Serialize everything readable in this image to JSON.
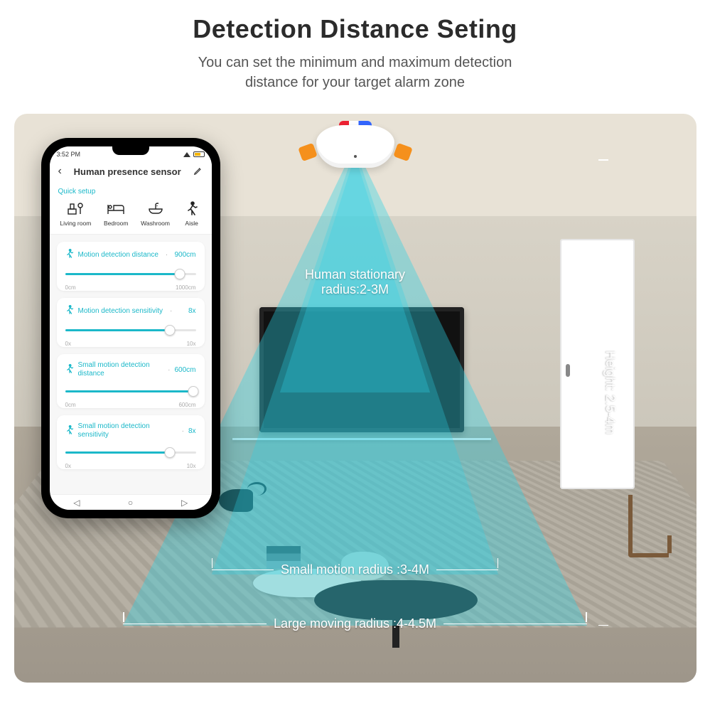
{
  "header": {
    "title": "Detection Distance Seting",
    "subtitle_l1": "You can set the minimum and maximum detection",
    "subtitle_l2": "distance for your target alarm zone"
  },
  "annotations": {
    "stationary_l1": "Human stationary",
    "stationary_l2": "radius:2-3M",
    "small_motion": "Small motion radius :3-4M",
    "large_motion": "Large moving radius :4-4.5M",
    "height": "Height: 2.5-4m"
  },
  "phone": {
    "status_time": "3:52 PM",
    "title": "Human presence sensor",
    "quick_label": "Quick setup",
    "quick": [
      {
        "label": "Living room"
      },
      {
        "label": "Bedroom"
      },
      {
        "label": "Washroom"
      },
      {
        "label": "Aisle"
      }
    ],
    "sliders": [
      {
        "name": "Motion detection distance",
        "value": "900cm",
        "min": "0cm",
        "max": "1000cm",
        "pct": 88
      },
      {
        "name": "Motion detection sensitivity",
        "value": "8x",
        "min": "0x",
        "max": "10x",
        "pct": 80
      },
      {
        "name": "Small motion detection distance",
        "value": "600cm",
        "min": "0cm",
        "max": "600cm",
        "pct": 98
      },
      {
        "name": "Small motion detection sensitivity",
        "value": "8x",
        "min": "0x",
        "max": "10x",
        "pct": 80
      }
    ],
    "nav": {
      "back": "◁",
      "home": "○",
      "recent": "◁"
    }
  }
}
